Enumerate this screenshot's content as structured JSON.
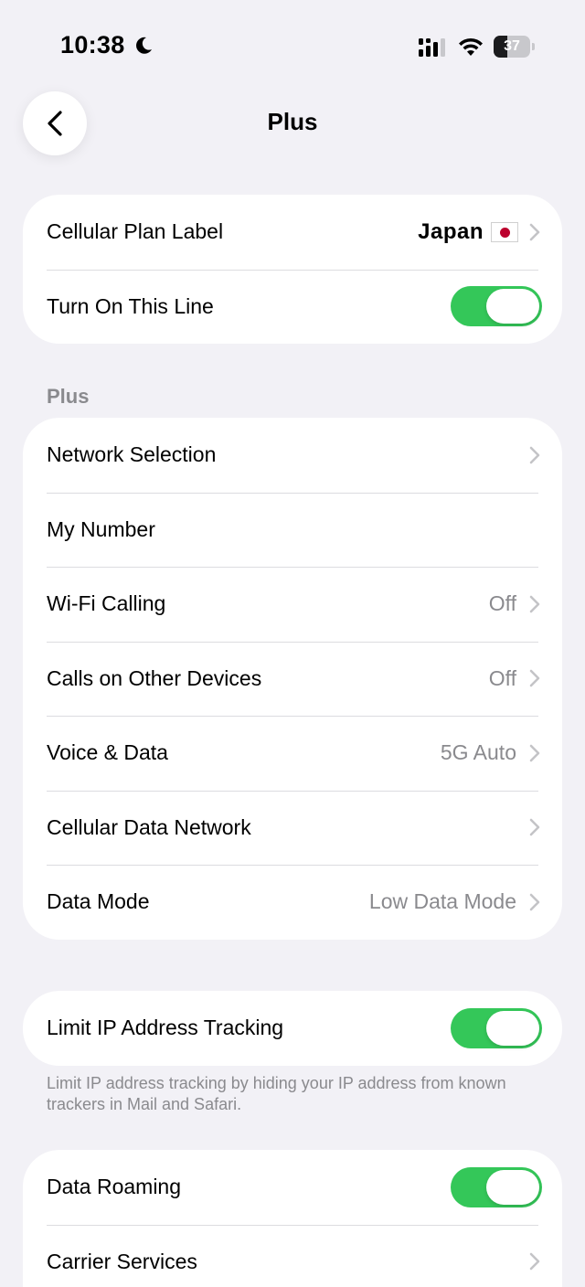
{
  "status_bar": {
    "time": "10:38",
    "battery_level": "37",
    "icons": [
      "moon-icon",
      "cellular-signal-icon",
      "wifi-icon",
      "battery-icon"
    ]
  },
  "nav": {
    "title": "Plus",
    "back_icon": "chevron-left-icon"
  },
  "plan_card": {
    "label_row": {
      "label": "Cellular Plan Label",
      "value": "Japan",
      "flag": "japan-flag-icon"
    },
    "line_row": {
      "label": "Turn On This Line",
      "on": true
    }
  },
  "plus_section": {
    "header": "Plus",
    "rows": [
      {
        "label": "Network Selection",
        "value": "",
        "chevron": true
      },
      {
        "label": "My Number",
        "value": "",
        "chevron": false
      },
      {
        "label": "Wi-Fi Calling",
        "value": "Off",
        "chevron": true
      },
      {
        "label": "Calls on Other Devices",
        "value": "Off",
        "chevron": true
      },
      {
        "label": "Voice & Data",
        "value": "5G Auto",
        "chevron": true
      },
      {
        "label": "Cellular Data Network",
        "value": "",
        "chevron": true
      },
      {
        "label": "Data Mode",
        "value": "Low Data Mode",
        "chevron": true
      }
    ]
  },
  "tracking_card": {
    "label": "Limit IP Address Tracking",
    "on": true,
    "footnote": "Limit IP address tracking by hiding your IP address from known trackers in Mail and Safari."
  },
  "roaming_card": {
    "rows": [
      {
        "label": "Data Roaming",
        "toggle": true,
        "on": true
      },
      {
        "label": "Carrier Services",
        "toggle": false,
        "chevron": true
      }
    ]
  },
  "colors": {
    "background": "#f2f1f6",
    "card": "#ffffff",
    "toggle_on": "#34c759",
    "secondary_text": "#8a8a8e",
    "chevron": "#c4c4c7"
  }
}
